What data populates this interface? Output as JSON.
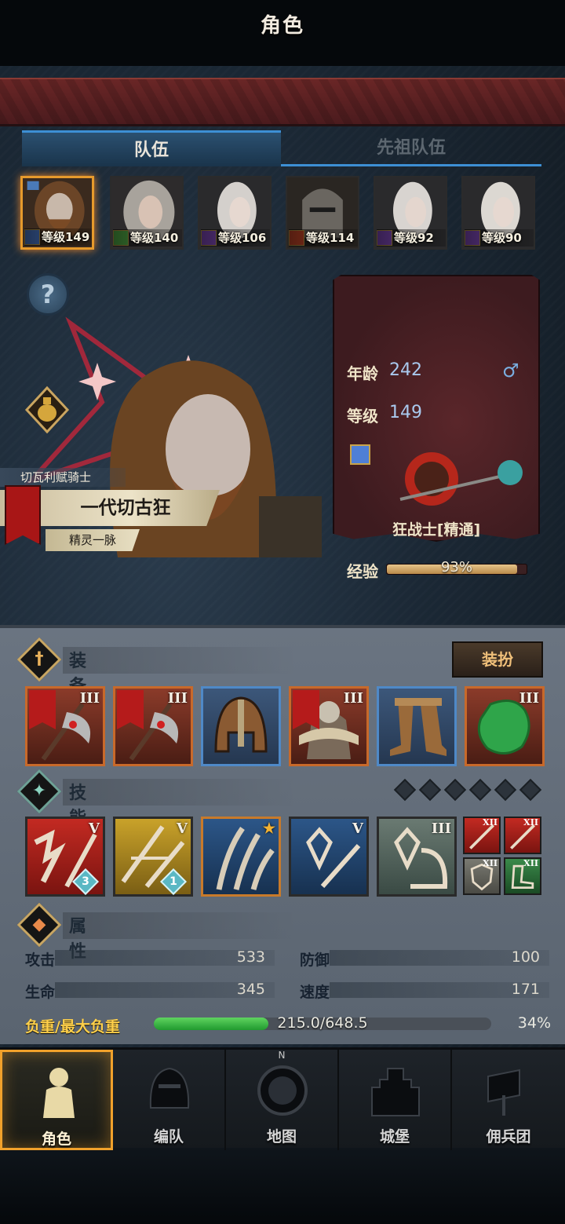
{
  "header": {
    "title": "角色"
  },
  "tabs": [
    {
      "label": "队伍"
    },
    {
      "label": "先祖队伍"
    }
  ],
  "roster": [
    {
      "level_text": "等级149",
      "class_color": "#4f7fd6"
    },
    {
      "level_text": "等级140",
      "class_color": "#58b94b"
    },
    {
      "level_text": "等级106",
      "class_color": "#8a4fc9"
    },
    {
      "level_text": "等级114",
      "class_color": "#d44a2a"
    },
    {
      "level_text": "等级92",
      "class_color": "#8a4fc9"
    },
    {
      "level_text": "等级90",
      "class_color": "#8a4fc9"
    }
  ],
  "hero": {
    "help_icon": "?",
    "title": "切瓦利赋骑士",
    "name": "一代切古狂",
    "race": "精灵一脉"
  },
  "info": {
    "age_label": "年龄",
    "age_value": "242",
    "gender_icon": "♂",
    "level_label": "等级",
    "level_value": "149",
    "class_name": "狂战士[精通]",
    "exp_label": "经验",
    "exp_percent_text": "93%",
    "exp_fraction": 0.93
  },
  "equipment": {
    "title": "装备",
    "outfit_button": "装扮",
    "items": [
      {
        "tier": "III"
      },
      {
        "tier": "III"
      },
      {
        "tier": ""
      },
      {
        "tier": "III"
      },
      {
        "tier": ""
      },
      {
        "tier": "III"
      }
    ]
  },
  "skills": {
    "title": "技能",
    "items": [
      {
        "tier": "V",
        "badge": "3"
      },
      {
        "tier": "V",
        "badge": "1"
      },
      {
        "tier": "★",
        "badge": ""
      },
      {
        "tier": "V",
        "badge": ""
      },
      {
        "tier": "III",
        "badge": ""
      }
    ],
    "passives": [
      {
        "tier": "XII"
      },
      {
        "tier": "XII"
      },
      {
        "tier": "XII"
      },
      {
        "tier": "XII"
      }
    ]
  },
  "attributes": {
    "title": "属性",
    "attack_label": "攻击",
    "attack_value": "533",
    "defense_label": "防御",
    "defense_value": "100",
    "hp_label": "生命",
    "hp_value": "345",
    "speed_label": "速度",
    "speed_value": "171",
    "load_label": "负重/最大负重",
    "load_text": "215.0/648.5",
    "load_percent_text": "34%",
    "load_fraction": 0.34
  },
  "nav": [
    {
      "label": "角色"
    },
    {
      "label": "编队"
    },
    {
      "label": "地图"
    },
    {
      "label": "城堡"
    },
    {
      "label": "佣兵团"
    }
  ],
  "map_compass": "N"
}
